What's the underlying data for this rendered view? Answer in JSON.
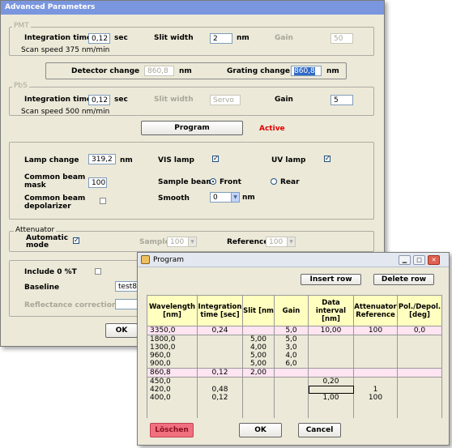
{
  "adv": {
    "title": "Advanced Parameters",
    "pmt": {
      "title": "PMT",
      "integration_label": "Integration time",
      "integration_value": "0,12",
      "integration_unit": "sec",
      "slit_label": "Slit width",
      "slit_value": "2",
      "slit_unit": "nm",
      "gain_label": "Gain",
      "gain_value": "50",
      "scan_speed": "Scan speed 375 nm/min"
    },
    "detector_label": "Detector change",
    "detector_value": "860,8",
    "detector_unit": "nm",
    "grating_label": "Grating change",
    "grating_value": "860,8",
    "grating_unit": "nm",
    "pbs": {
      "title": "PbS",
      "integration_label": "Integration time",
      "integration_value": "0,12",
      "integration_unit": "sec",
      "slit_label": "Slit width",
      "slit_value": "Servo",
      "gain_label": "Gain",
      "gain_value": "5",
      "scan_speed": "Scan speed 500 nm/min"
    },
    "program_button": "Program",
    "active_label": "Active",
    "lamp_change_label": "Lamp change",
    "lamp_change_value": "319,2",
    "lamp_change_unit": "nm",
    "vis_lamp_label": "VIS lamp",
    "uv_lamp_label": "UV lamp",
    "common_beam_mask_label1": "Common beam",
    "common_beam_mask_label2": "mask",
    "common_beam_mask_value": "100",
    "sample_beam_label": "Sample beam",
    "front_label": "Front",
    "rear_label": "Rear",
    "depol_label1": "Common beam",
    "depol_label2": "depolarizer",
    "smooth_label": "Smooth",
    "smooth_value": "0",
    "smooth_unit": "nm",
    "attenuator_title": "Attenuator",
    "automatic_label1": "Automatic",
    "automatic_label2": "mode",
    "sample_label": "Sample",
    "sample_value": "100",
    "reference_label": "Reference",
    "reference_value": "100",
    "include_label": "Include 0 %T",
    "baseline_label": "Baseline",
    "baseline_value": "test8",
    "reflectance_label": "Reflectance correction",
    "ok_button": "OK"
  },
  "prog": {
    "title": "Program",
    "insert_button": "Insert row",
    "delete_button": "Delete row",
    "headers": [
      "Wavelength [nm]",
      "Integration time [sec]",
      "Slit [nm",
      "Gain",
      "Data interval [nm]",
      "Attenuator Reference",
      "Pol./Depol. [deg]"
    ],
    "rows": [
      [
        "3350,0",
        "0,24",
        "",
        "5,0",
        "10,00",
        "100",
        "0,0"
      ],
      [
        "1800,0",
        "",
        "5,00",
        "5,0",
        "",
        "",
        ""
      ],
      [
        "1300,0",
        "",
        "4,00",
        "3,0",
        "",
        "",
        ""
      ],
      [
        "960,0",
        "",
        "5,00",
        "4,0",
        "",
        "",
        ""
      ],
      [
        "900,0",
        "",
        "5,00",
        "6,0",
        "",
        "",
        ""
      ],
      [
        "860,8",
        "0,12",
        "2,00",
        "",
        "",
        "",
        ""
      ],
      [
        "450,0",
        "",
        "",
        "",
        "0,20",
        "",
        ""
      ],
      [
        "420,0",
        "0,48",
        "",
        "",
        "",
        "1",
        ""
      ],
      [
        "400,0",
        "0,12",
        "",
        "",
        "1,00",
        "100",
        ""
      ],
      [
        "",
        "",
        "",
        "",
        "",
        "",
        ""
      ],
      [
        "",
        "",
        "",
        "",
        "",
        "",
        ""
      ]
    ],
    "pink_rows": [
      0,
      5
    ],
    "loschen_button": "Löschen",
    "ok_button": "OK",
    "cancel_button": "Cancel"
  }
}
